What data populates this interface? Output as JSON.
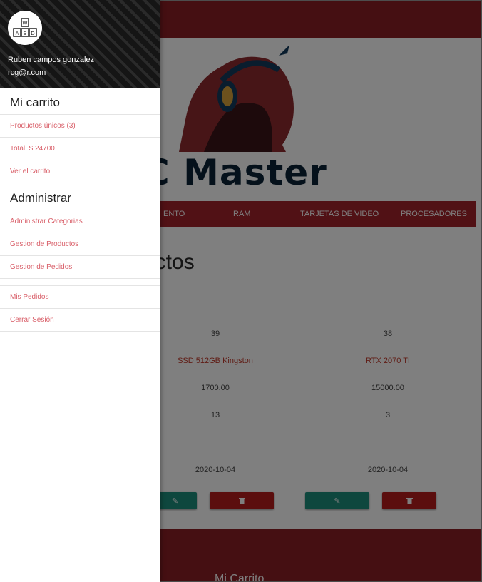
{
  "background_page": {
    "brand_text": "C Master",
    "nav": {
      "items": [
        "ENTO",
        "RAM",
        "TARJETAS DE VIDEO",
        "PROCESADORES"
      ]
    },
    "section_title": "uctos",
    "products": [
      {
        "id": "39",
        "name": "SSD 512GB Kingston",
        "price": "1700.00",
        "stock": "13",
        "date": "2020-10-04"
      },
      {
        "id": "38",
        "name": "RTX 2070 TI",
        "price": "15000.00",
        "stock": "3",
        "date": "2020-10-04"
      }
    ],
    "footer_title": "Mi Carrito"
  },
  "drawer": {
    "user": {
      "name": "Ruben campos gonzalez",
      "email": "rcg@r.com"
    },
    "cart": {
      "header": "Mi carrito",
      "unique_products": "Productos únicos (3)",
      "total": "Total: $ 24700",
      "view_cart": "Ver el carrito"
    },
    "admin": {
      "header": "Administrar",
      "items": [
        "Administrar Categorias",
        "Gestion de Productos",
        "Gestion de Pedidos"
      ]
    },
    "account": {
      "my_orders": "Mis Pedidos",
      "logout": "Cerrar Sesión"
    }
  },
  "colors": {
    "brand_dark_red": "#8b1e24",
    "nav_red": "#a3222a",
    "edit_teal": "#1c8e7c",
    "delete_red": "#b71c1c",
    "link_pink": "#d9606a"
  },
  "icons": {
    "avatar": "keyboard-keys-asd-icon",
    "edit": "pencil-icon",
    "delete": "trash-icon",
    "brand": "hooded-gamer-headphones-logo"
  }
}
